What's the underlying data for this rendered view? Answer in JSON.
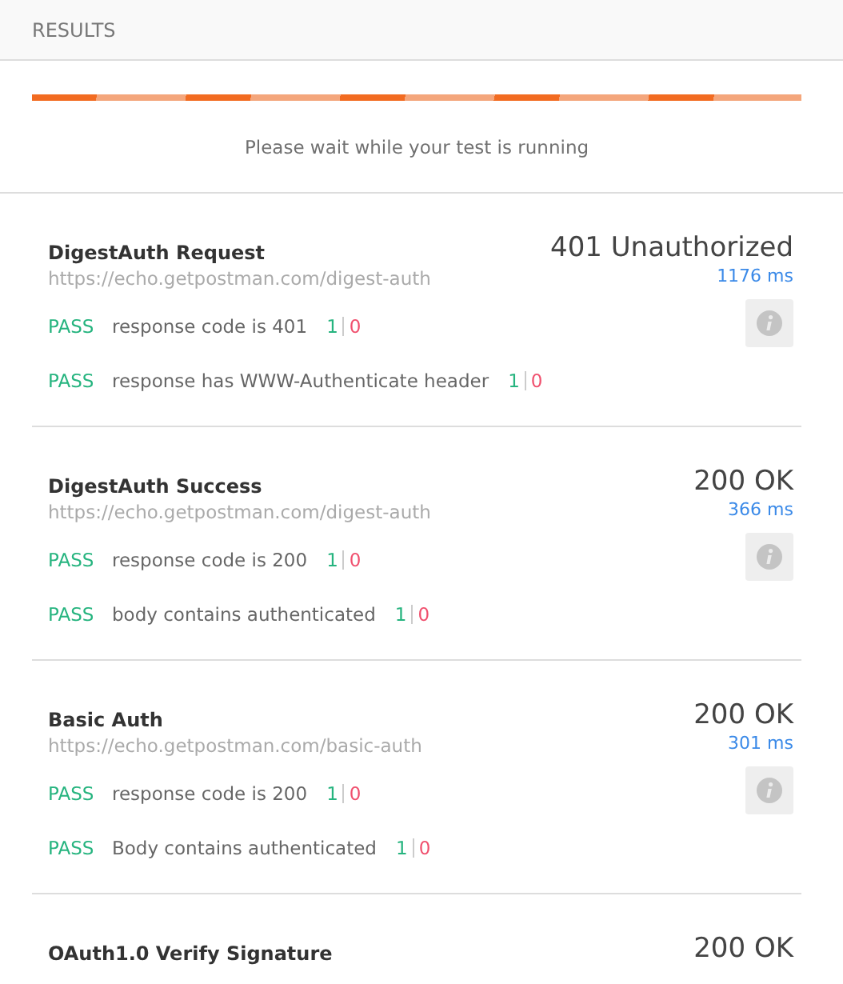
{
  "header": {
    "title": "RESULTS"
  },
  "progress": {
    "level": 1,
    "message": "Please wait while your test is running"
  },
  "requests": [
    {
      "name": "DigestAuth Request",
      "url": "https://echo.getpostman.com/digest-auth",
      "status": "401 Unauthorized",
      "time": "1176 ms",
      "tests": [
        {
          "result": "PASS",
          "name": "response code is 401",
          "passed": "1",
          "failed": "0"
        },
        {
          "result": "PASS",
          "name": "response has WWW-Authenticate header",
          "passed": "1",
          "failed": "0"
        }
      ]
    },
    {
      "name": "DigestAuth Success",
      "url": "https://echo.getpostman.com/digest-auth",
      "status": "200 OK",
      "time": "366 ms",
      "tests": [
        {
          "result": "PASS",
          "name": "response code is 200",
          "passed": "1",
          "failed": "0"
        },
        {
          "result": "PASS",
          "name": "body contains authenticated",
          "passed": "1",
          "failed": "0"
        }
      ]
    },
    {
      "name": "Basic Auth",
      "url": "https://echo.getpostman.com/basic-auth",
      "status": "200 OK",
      "time": "301 ms",
      "tests": [
        {
          "result": "PASS",
          "name": "response code is 200",
          "passed": "1",
          "failed": "0"
        },
        {
          "result": "PASS",
          "name": "Body contains authenticated",
          "passed": "1",
          "failed": "0"
        }
      ]
    },
    {
      "name": "OAuth1.0 Verify Signature",
      "status": "200 OK"
    }
  ]
}
